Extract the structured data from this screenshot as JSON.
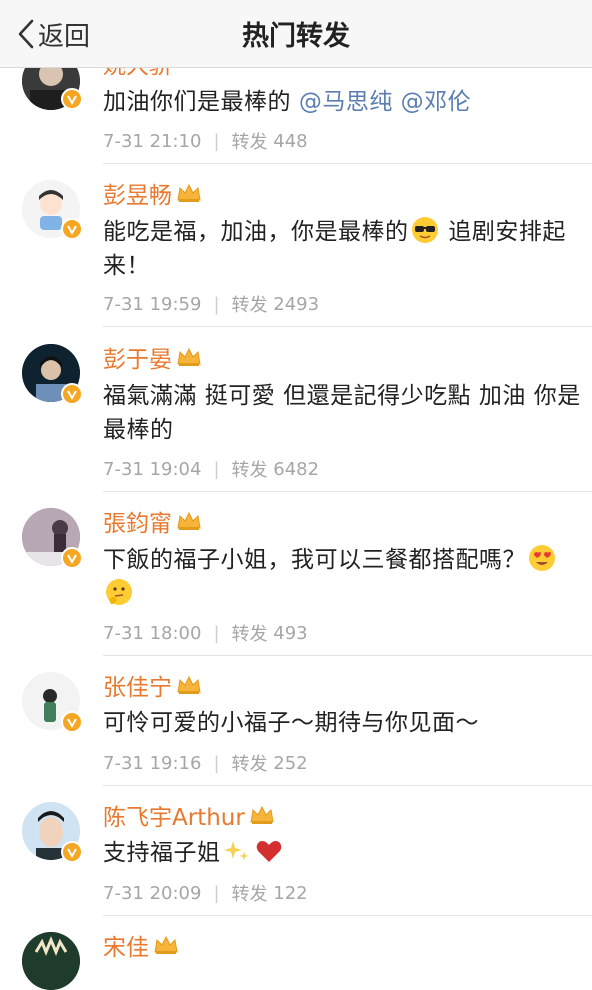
{
  "nav": {
    "back_label": "返回",
    "title": "热门转发"
  },
  "items": [
    {
      "name": "姚大骄",
      "text": "加油你们是最棒的",
      "mentions": [
        "@马思纯",
        "@邓伦"
      ],
      "time": "7-31 21:10",
      "repost_label": "转发",
      "repost_count": "448"
    },
    {
      "name": "彭昱畅",
      "text": "能吃是福，加油，你是最棒的",
      "text_after": "追剧安排起来！",
      "time": "7-31 19:59",
      "repost_label": "转发",
      "repost_count": "2493"
    },
    {
      "name": "彭于晏",
      "text": "福氣滿滿 挺可愛 但還是記得少吃點 加油 你是最棒的",
      "time": "7-31 19:04",
      "repost_label": "转发",
      "repost_count": "6482"
    },
    {
      "name": "張鈞甯",
      "text": "下飯的福子小姐，我可以三餐都搭配嗎？",
      "time": "7-31 18:00",
      "repost_label": "转发",
      "repost_count": "493"
    },
    {
      "name": "张佳宁",
      "text": "可怜可爱的小福子～期待与你见面～",
      "time": "7-31 19:16",
      "repost_label": "转发",
      "repost_count": "252"
    },
    {
      "name": "陈飞宇Arthur",
      "text": "支持福子姐",
      "time": "7-31 20:09",
      "repost_label": "转发",
      "repost_count": "122"
    },
    {
      "name": "宋佳"
    }
  ],
  "icons": {
    "back": "chevron-left-icon",
    "verified": "verified-badge-icon",
    "member": "crown-icon"
  },
  "colors": {
    "name": "#e8792f",
    "mention": "#5b7db1",
    "meta": "#a6a6a6",
    "verified": "#f5a623"
  }
}
